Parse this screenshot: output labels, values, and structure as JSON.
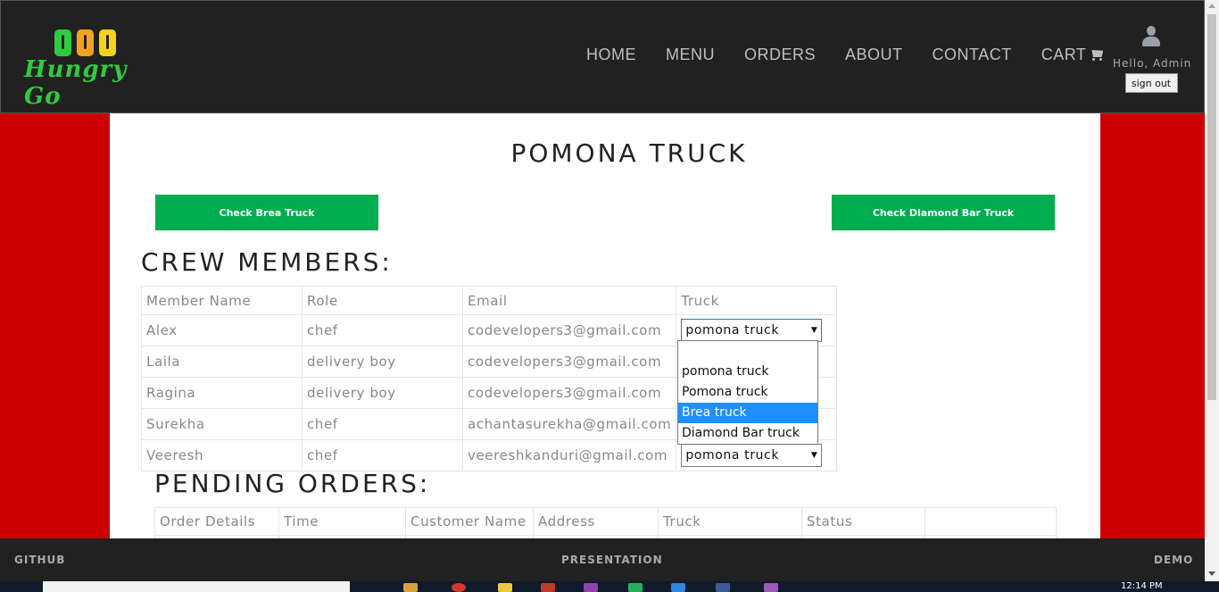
{
  "header": {
    "logo_text": "Hungry Go",
    "nav": [
      {
        "label": "HOME"
      },
      {
        "label": "MENU"
      },
      {
        "label": "ORDERS"
      },
      {
        "label": "ABOUT"
      },
      {
        "label": "CONTACT"
      },
      {
        "label": "CART"
      }
    ],
    "user": {
      "greeting": "Hello, Admin",
      "signout_label": "sign out"
    }
  },
  "main": {
    "title": "POMONA TRUCK",
    "buttons": {
      "brea": "Check Brea Truck",
      "diamond": "Check Diamond Bar Truck"
    },
    "crew": {
      "title": "CREW MEMBERS:",
      "columns": [
        "Member Name",
        "Role",
        "Email",
        "Truck"
      ],
      "rows": [
        {
          "name": "Alex",
          "role": "chef",
          "email": "codevelopers3@gmail.com",
          "truck": "pomona truck"
        },
        {
          "name": "Laila",
          "role": "delivery boy",
          "email": "codevelopers3@gmail.com",
          "truck": "pomona truck"
        },
        {
          "name": "Ragina",
          "role": "delivery boy",
          "email": "codevelopers3@gmail.com",
          "truck": "pomona truck"
        },
        {
          "name": "Surekha",
          "role": "chef",
          "email": "achantasurekha@gmail.com",
          "truck": "pomona truck"
        },
        {
          "name": "Veeresh",
          "role": "chef",
          "email": "veereshkanduri@gmail.com",
          "truck": "pomona truck"
        }
      ]
    },
    "truck_dropdown": {
      "options": [
        "",
        "pomona truck",
        "Pomona truck",
        "Brea truck",
        "Diamond Bar truck"
      ],
      "highlighted": "Brea truck"
    },
    "orders": {
      "title": "PENDING ORDERS:",
      "columns": [
        "Order Details",
        "Time",
        "Customer Name",
        "Address",
        "Truck",
        "Status",
        ""
      ]
    }
  },
  "footer": {
    "github": "GITHUB",
    "presentation": "PRESENTATION",
    "demo": "DEMO"
  },
  "taskbar": {
    "clock": "12:14 PM"
  },
  "colors": {
    "page_bg": "#cc0000",
    "header_bg": "#212121",
    "button_green": "#00ad4f",
    "select_highlight": "#1e90ff"
  }
}
